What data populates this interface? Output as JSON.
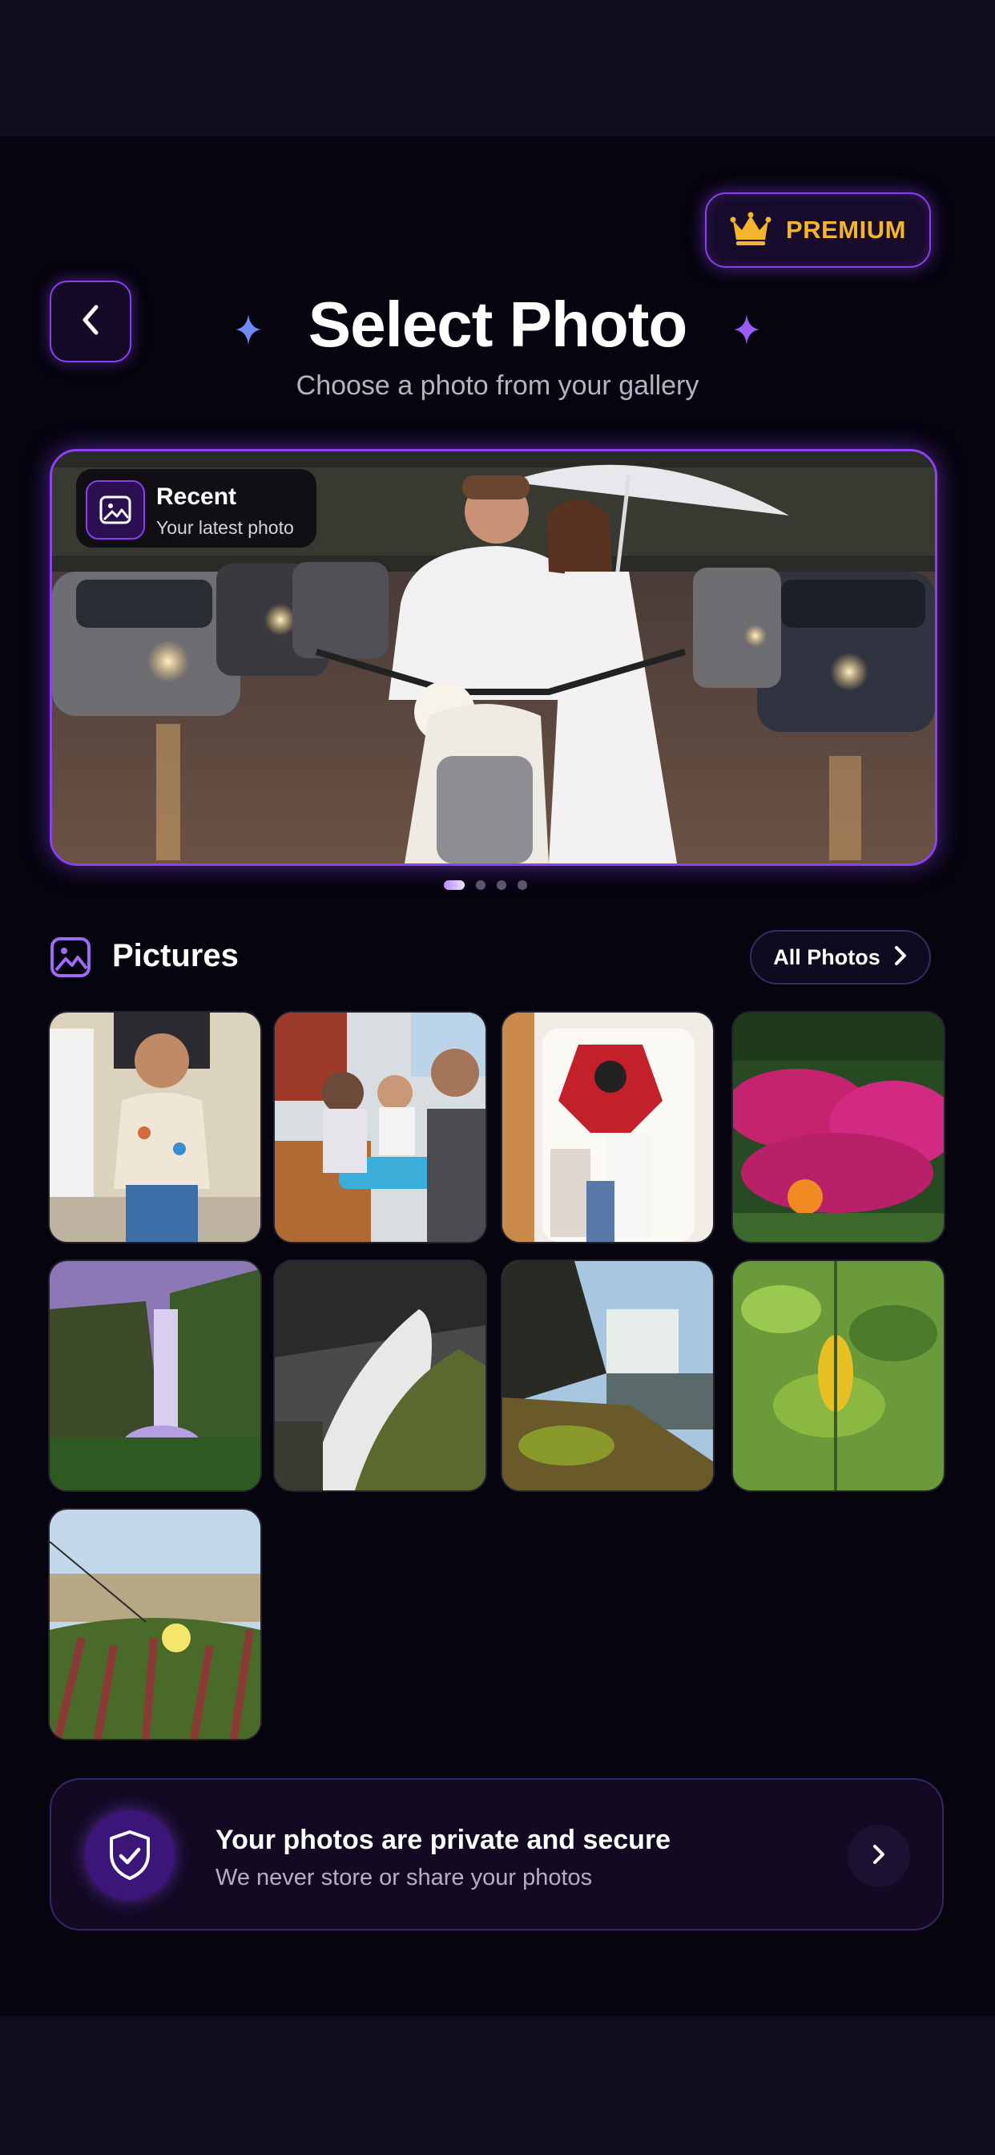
{
  "header": {
    "premium_label": "PREMIUM",
    "title_main": "Select ",
    "title_accent": "Photo",
    "subtitle": "Choose a photo from your gallery"
  },
  "hero": {
    "badge_title": "Recent",
    "badge_subtitle": "Your latest photo",
    "pagination": {
      "total": 4,
      "active": 1
    }
  },
  "pictures": {
    "title": "Pictures",
    "all_photos_label": "All Photos",
    "thumbnails": [
      "child-portrait-photo",
      "family-restaurant-photo",
      "family-robot-statue-photo",
      "magenta-flowers-photo",
      "waterfall-purple-sky-photo",
      "black-white-waterfall-photo",
      "mossy-cliff-waterfall-photo",
      "green-leaves-photo",
      "beach-grass-flower-photo"
    ]
  },
  "privacy": {
    "title": "Your photos are private and secure",
    "subtitle": "We never store or share your photos"
  },
  "colors": {
    "accent_purple": "#8a3ff0",
    "premium_gold": "#f5b52a",
    "background": "#06040f"
  },
  "icons": {
    "premium": "crown-icon",
    "back": "chevron-left-icon",
    "recent": "image-icon",
    "pictures": "gallery-icon",
    "all_photos": "chevron-right-icon",
    "privacy": "shield-check-icon"
  }
}
